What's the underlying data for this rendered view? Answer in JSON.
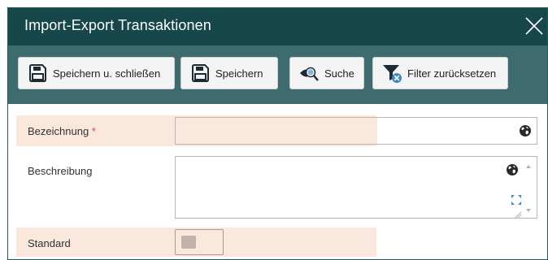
{
  "dialog": {
    "title": "Import-Export Transaktionen",
    "close_icon": "close-icon"
  },
  "toolbar": {
    "buttons": [
      {
        "label": "Speichern u. schließen",
        "icon": "save-icon"
      },
      {
        "label": "Speichern",
        "icon": "save-icon"
      },
      {
        "label": "Suche",
        "icon": "search-icon"
      },
      {
        "label": "Filter zurücksetzen",
        "icon": "filter-reset-icon"
      }
    ]
  },
  "form": {
    "bezeichnung": {
      "label": "Bezeichnung",
      "required_mark": "*",
      "value": ""
    },
    "beschreibung": {
      "label": "Beschreibung",
      "value": ""
    },
    "standard": {
      "label": "Standard",
      "value": false
    }
  },
  "colors": {
    "titlebar": "#16474a",
    "toolbar": "#3e6c6e",
    "highlight": "#fbe8dd",
    "required": "#e0474c"
  }
}
